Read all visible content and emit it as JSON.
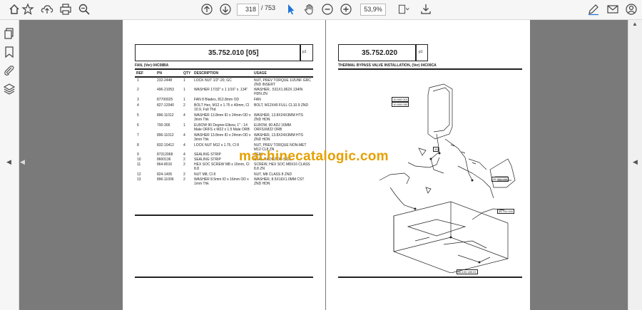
{
  "toolbar": {
    "page_current": "318",
    "page_total": "/ 753",
    "zoom": "53,9%"
  },
  "left_page": {
    "part_number": "35.752.010 [05]",
    "page_marker": "p1",
    "section_title": "FAN, (Ver) 04C08BA",
    "columns": [
      "REF",
      "PN",
      "QTY",
      "DESCRIPTION",
      "USAGE"
    ],
    "rows": [
      {
        "ref": "1",
        "pn": "232-2448",
        "qty": "1",
        "desc": "LOCK NUT 1/2\"-20, GC",
        "usage": "NUT, PREV TORQUE 1/2UNF GRC ZND INSERT"
      },
      {
        "ref": "2",
        "pn": "496-21053",
        "qty": "1",
        "desc": "WASHER 17/32\" x 1 1/16\" x .134\"",
        "usage": "WASHER, .531X1.062X.134IN HDN ZN"
      },
      {
        "ref": "3",
        "pn": "87700025",
        "qty": "1",
        "desc": "FAN 8 Blades, 812.8mm OD",
        "usage": "FAN"
      },
      {
        "ref": "4",
        "pn": "827-12040",
        "qty": "2",
        "desc": "BOLT Hex, M12 x 1.75 x 40mm, Cl 10.9, Full Thd",
        "usage": "BOLT, M12X40 FULL CL10.9 ZND"
      },
      {
        "ref": "5",
        "pn": "896-11012",
        "qty": "4",
        "desc": "WASHER 13.8mm ID x 24mm OD x 3mm Thk",
        "usage": "WASHER, 13.8X24X3MM HTS ZND HDN"
      },
      {
        "ref": "6",
        "pn": "700-306",
        "qty": "1",
        "desc": "ELBOW 90 Degree Elbow, 1\" - 14 Male ORFS x M22 x 1.5 Male ORB",
        "usage": "ELBOW, 90 ADJ 16MM ORFSXM22 ORB"
      },
      {
        "ref": "7",
        "pn": "896-11012",
        "qty": "4",
        "desc": "WASHER 13.8mm ID x 24mm OD x 3mm Thk",
        "usage": "WASHER, 13.8X24X3MM HTS ZND HDN"
      },
      {
        "ref": "8",
        "pn": "832-10412",
        "qty": "4",
        "desc": "LOCK NUT M12 x 1.75, Cl 8",
        "usage": "NUT, PREV TORQUE NON-MET M12 CL8 ZN"
      },
      {
        "ref": "9",
        "pn": "87312068",
        "qty": "4",
        "desc": "SEALING STRIP",
        "usage": "SEAL"
      },
      {
        "ref": "10",
        "pn": "8600136",
        "qty": "2",
        "desc": "SEALING STRIP",
        "usage": "SEAL RADIATOR-SIDE"
      },
      {
        "ref": "11",
        "pn": "864-8016",
        "qty": "2",
        "desc": "HEX SOC SCREW M8 x 16mm, Cl 8.8",
        "usage": "SCREW, HEX SOC M8X16 CLASS 8.8 ZN"
      },
      {
        "ref": "12",
        "pn": "824-1405",
        "qty": "2",
        "desc": "NUT M8, Cl 8",
        "usage": "NUT, M8 CLASS 8 ZND"
      },
      {
        "ref": "13",
        "pn": "896-11006",
        "qty": "2",
        "desc": "WASHER 8.5mm ID x 16mm OD x 1mm Thk",
        "usage": "WASHER, 8.5X16X1.0MM CST ZND HDN"
      }
    ]
  },
  "right_page": {
    "part_number": "35.752.020",
    "page_marker": "p1",
    "section_title": "THERMAL BYPASS VALVE INSTALLATION, (Ver) 04C09CA",
    "callouts": [
      "10.400.010",
      "10.400.030",
      "35.300.030",
      "35.702.000",
      "35.100.180.01",
      "20"
    ]
  },
  "watermark": "machinecatalogic.com",
  "colors": {
    "viewer_bg": "#7a7a7a",
    "toolbar_bg": "#f6f6f6",
    "accent_blue": "#1e73d8",
    "watermark": "#e5a000"
  }
}
